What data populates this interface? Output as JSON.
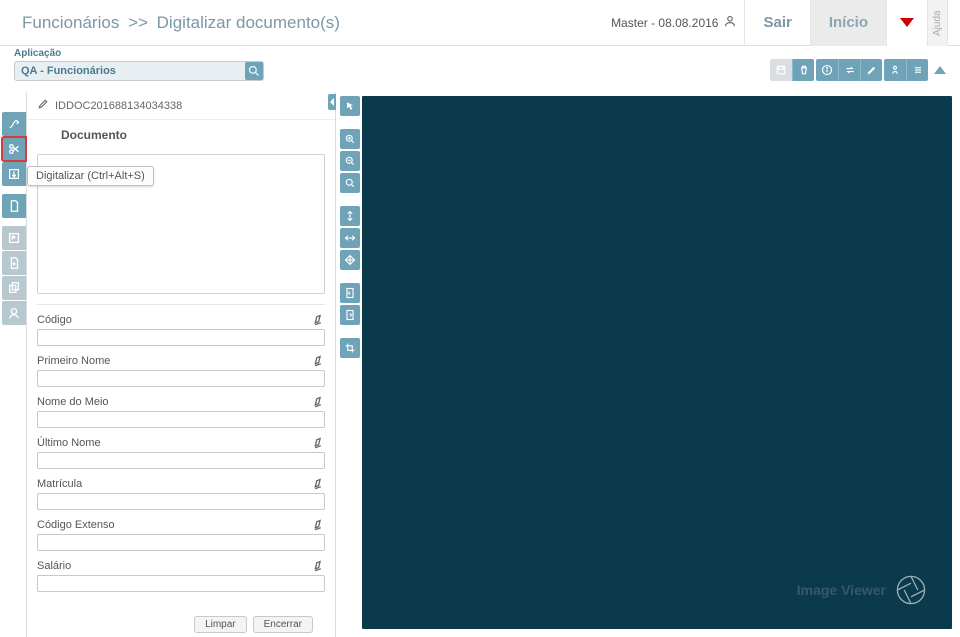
{
  "header": {
    "crumb1": "Funcionários",
    "sep": ">>",
    "crumb2": "Digitalizar documento(s)",
    "user": "Master - 08.08.2016",
    "sair": "Sair",
    "inicio": "Início",
    "ajuda": "Ajuda"
  },
  "app": {
    "label": "Aplicação",
    "value": "QA - Funcionários"
  },
  "panel": {
    "doc_id": "IDDOC201688134034338",
    "doc_title": "Documento",
    "tooltip": "Digitalizar (Ctrl+Alt+S)"
  },
  "fields": [
    {
      "label": "Código",
      "value": ""
    },
    {
      "label": "Primeiro Nome",
      "value": ""
    },
    {
      "label": "Nome do Meio",
      "value": ""
    },
    {
      "label": "Último Nome",
      "value": ""
    },
    {
      "label": "Matrícula",
      "value": ""
    },
    {
      "label": "Código Extenso",
      "value": ""
    },
    {
      "label": "Salário",
      "value": ""
    }
  ],
  "buttons": {
    "limpar": "Limpar",
    "encerrar": "Encerrar"
  },
  "viewer": {
    "watermark": "Image Viewer"
  },
  "colors": {
    "accent": "#6fa3b8",
    "viewer_bg": "#0b3a4c",
    "danger": "#d63b3b"
  }
}
